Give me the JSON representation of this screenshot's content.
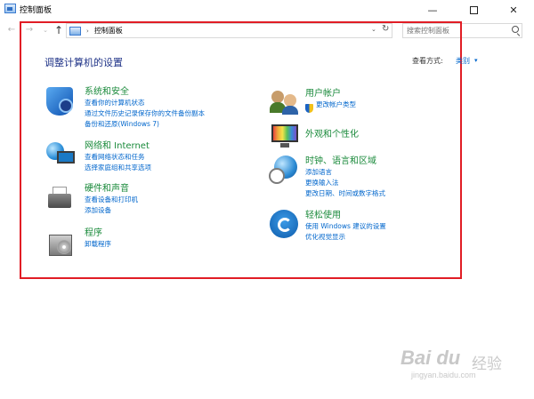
{
  "window": {
    "title": "控制面板",
    "minimize": "—",
    "close": "✕"
  },
  "navbar": {
    "back": "←",
    "forward": "→",
    "recent": "⌄",
    "up": "↑",
    "separator": "›",
    "address": "控制面板",
    "dropdown": "⌄",
    "refresh": "↻",
    "search_placeholder": "搜索控制面板"
  },
  "content": {
    "heading": "调整计算机的设置",
    "view_by_label": "查看方式:",
    "view_by_value": "类别",
    "view_by_arrow": "▾",
    "left": [
      {
        "title": "系统和安全",
        "links": [
          "查看你的计算机状态",
          "通过文件历史记录保存你的文件备份副本",
          "备份和还原(Windows 7)"
        ]
      },
      {
        "title": "网络和 Internet",
        "links": [
          "查看网络状态和任务",
          "选择家庭组和共享选项"
        ]
      },
      {
        "title": "硬件和声音",
        "links": [
          "查看设备和打印机",
          "添加设备"
        ]
      },
      {
        "title": "程序",
        "links": [
          "卸载程序"
        ]
      }
    ],
    "right": [
      {
        "title": "用户帐户",
        "links": [
          "更改帐户类型"
        ]
      },
      {
        "title": "外观和个性化",
        "links": []
      },
      {
        "title": "时钟、语言和区域",
        "links": [
          "添加语言",
          "更换输入法",
          "更改日期、时间或数字格式"
        ]
      },
      {
        "title": "轻松使用",
        "links": [
          "使用 Windows 建议的设置",
          "优化视觉显示"
        ]
      }
    ]
  },
  "watermark": {
    "logo": "Bai du",
    "brand": "经验",
    "url": "jingyan.baidu.com"
  },
  "colors": {
    "heading": "#1e3287",
    "category_title": "#1a8a3b",
    "link": "#0066cc",
    "highlight_frame": "#e11d25"
  }
}
